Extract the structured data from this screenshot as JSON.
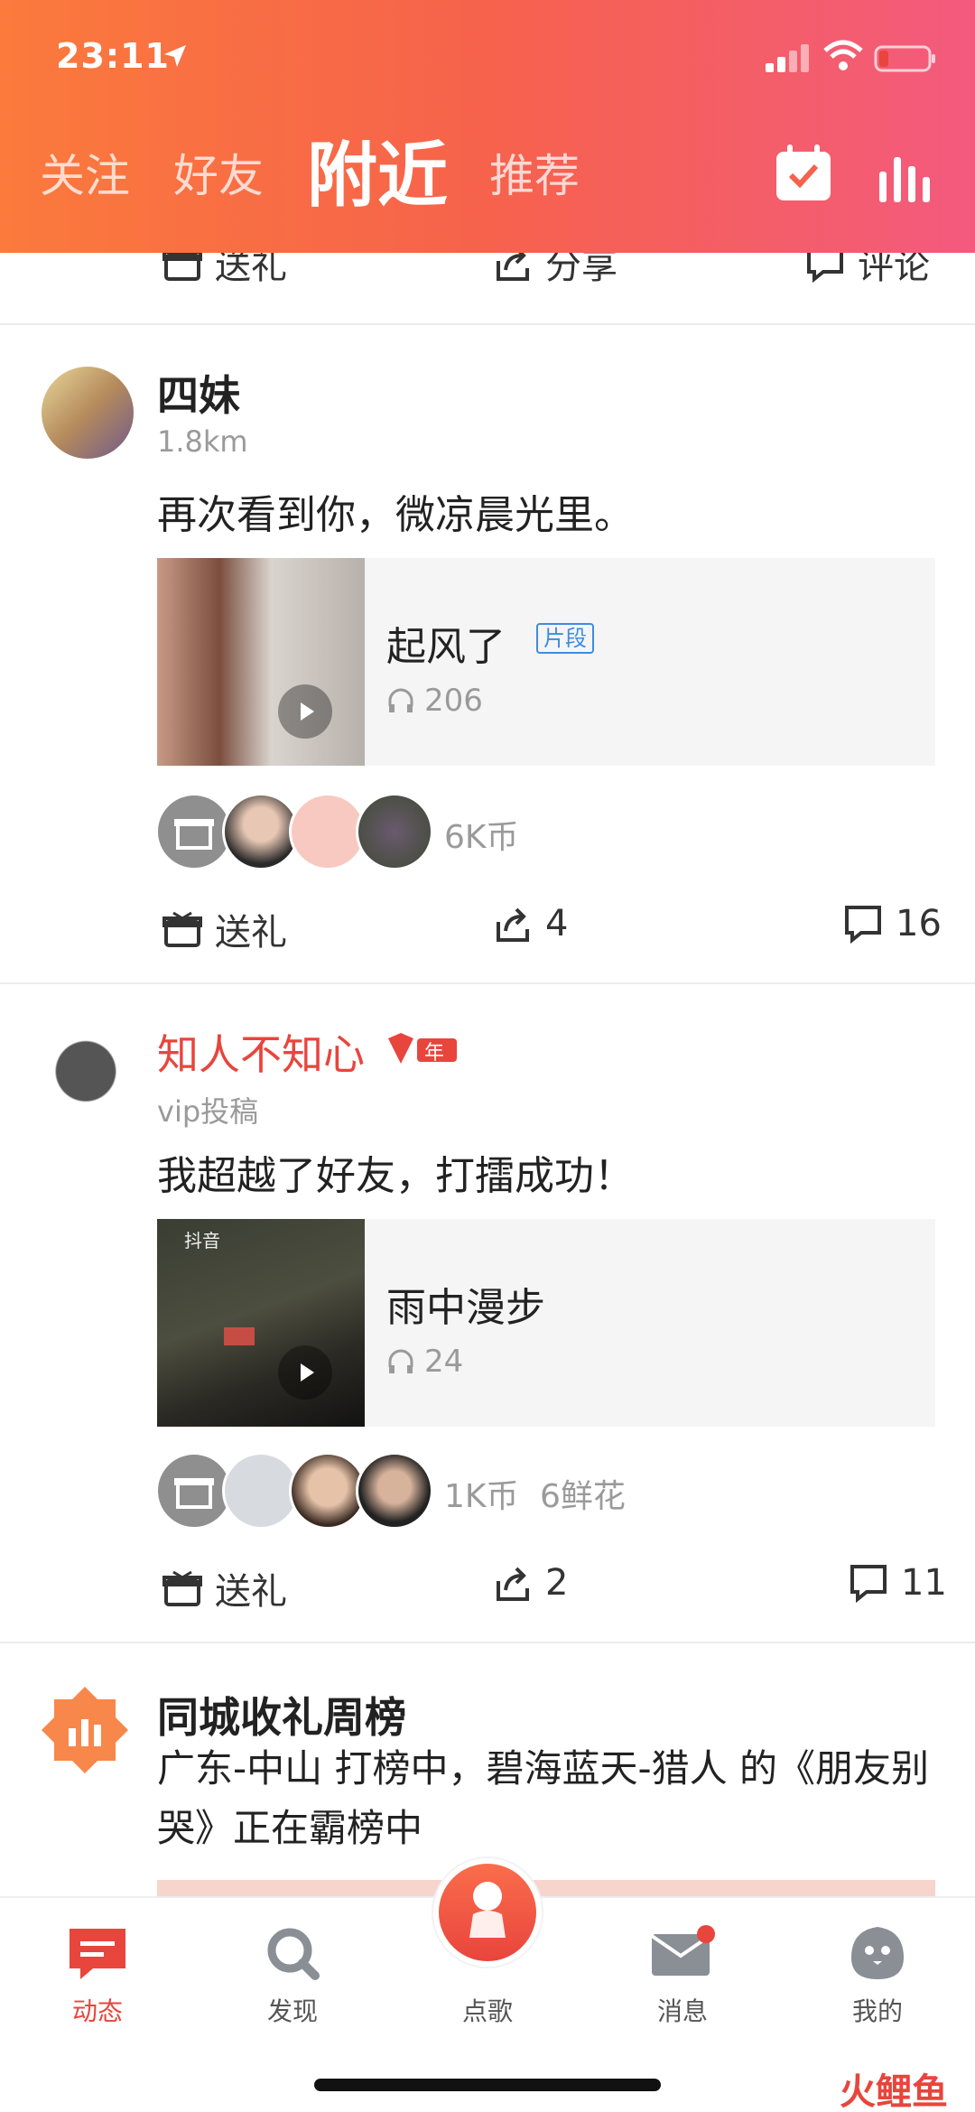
{
  "status": {
    "time": "23:11"
  },
  "tabs": [
    {
      "label": "关注"
    },
    {
      "label": "好友"
    },
    {
      "label": "附近",
      "active": true
    },
    {
      "label": "推荐"
    }
  ],
  "top_actions": {
    "gift": "送礼",
    "share": "分享",
    "comment": "评论"
  },
  "posts": [
    {
      "name": "四妹",
      "sub": "1.8km",
      "text": "再次看到你，微凉晨光里。",
      "song_title": "起风了",
      "song_tag": "片段",
      "plays": "206",
      "gift_summary": "6K币",
      "actions": {
        "gift": "送礼",
        "share": "4",
        "comment": "16"
      }
    },
    {
      "name": "知人不知心",
      "badge": "年",
      "sub": "vip投稿",
      "text": "我超越了好友，打擂成功！",
      "cover_caption": "抖音",
      "song_title": "雨中漫步",
      "plays": "24",
      "gift_summary": "1K币",
      "gift_summary2": "6鲜花",
      "actions": {
        "gift": "送礼",
        "share": "2",
        "comment": "11"
      }
    }
  ],
  "rank_post": {
    "title": "同城收礼周榜",
    "text": "广东-中山 打榜中，碧海蓝天-猎人 的《朋友别哭》正在霸榜中"
  },
  "bottom_nav": [
    {
      "label": "动态",
      "icon": "feed-icon",
      "active": true
    },
    {
      "label": "发现",
      "icon": "search-icon"
    },
    {
      "label": "点歌",
      "icon": "sing-icon"
    },
    {
      "label": "消息",
      "icon": "mail-icon"
    },
    {
      "label": "我的",
      "icon": "profile-icon"
    }
  ],
  "watermark": "火鲤鱼",
  "colors": {
    "accent": "#e8453c",
    "header_start": "#fb7a3c",
    "header_end": "#f35a7e"
  }
}
